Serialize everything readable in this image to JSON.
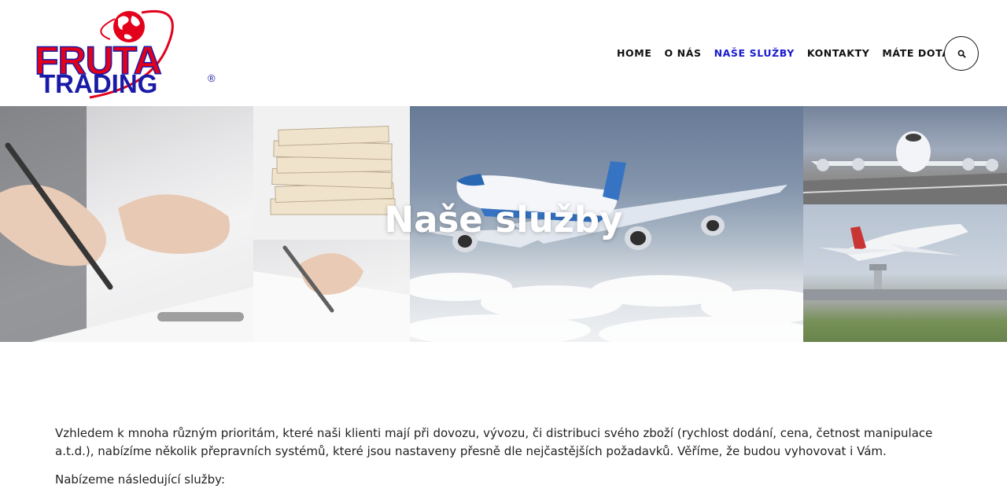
{
  "header": {
    "logo": {
      "brand_line_1": "FRUTA",
      "brand_line_2": "TRADING",
      "registered_mark": "®",
      "colors": {
        "red": "#e3001b",
        "blue": "#1a1aa8"
      }
    },
    "nav": [
      {
        "label": "HOME",
        "active": false
      },
      {
        "label": "O NÁS",
        "active": false
      },
      {
        "label": "NAŠE SLUŽBY",
        "active": true
      },
      {
        "label": "KONTAKTY",
        "active": false
      },
      {
        "label": "MÁTE DOTAZ?",
        "active": false
      }
    ],
    "search_icon": "search-icon",
    "accent_color": "#1a1acc"
  },
  "hero": {
    "title": "Naše služby"
  },
  "content": {
    "intro": "Vzhledem k mnoha různým prioritám, které naši klienti mají při dovozu, vývozu, či distribuci svého zboží (rychlost dodání, cena, četnost manipulace a.t.d.), nabízíme několik přepravních systémů, které jsou nastaveny přesně dle nejčastějších požadavků. Věříme, že budou vyhovovat i Vám.",
    "services_lead": "Nabízeme následující služby:"
  }
}
